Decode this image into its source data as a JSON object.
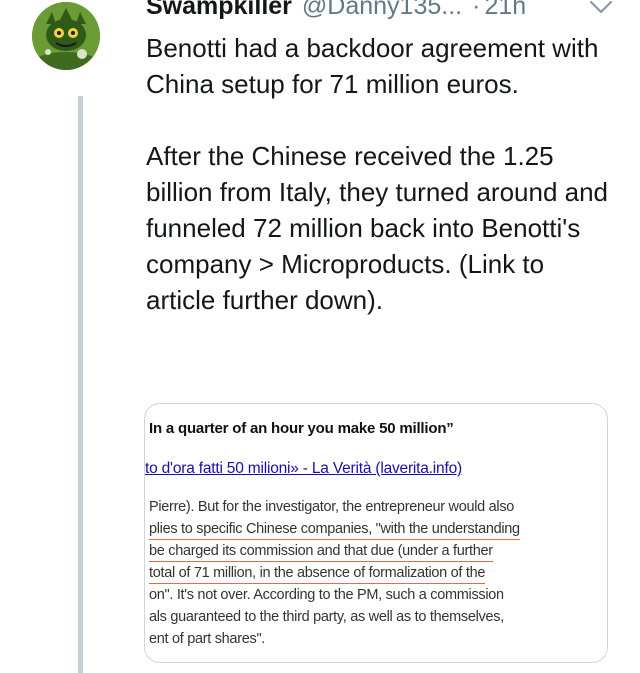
{
  "tweet": {
    "author": {
      "display_name": "Swampkiller",
      "handle": "@Danny135...",
      "avatar_icon": "cartoon-monster-avatar-icon"
    },
    "separator": "·",
    "timestamp": "21h",
    "more_icon": "chevron-down-icon",
    "text_paragraphs": [
      "Benotti had a backdoor agreement with China setup for 71 million euros.",
      "After the Chinese received the 1.25 billion from Italy, they turned around and funneled 72 million back into Benotti's company > Microproducts. (Link to article further down)."
    ]
  },
  "media_card": {
    "heading": "In a quarter of an hour you make 50 million”",
    "link_text": "to d'ora fatti 50 milioni» - La Verità (laverita.info)",
    "body_lines": [
      "Pierre). But for the investigator, the entrepreneur would also",
      "plies to specific Chinese companies, \"with the understanding",
      "be charged its commission and that due (under a further",
      "total of 71 million, in the absence of formalization of the",
      "on\". It's not over. According to the PM, such a commission",
      "als guaranteed to the third party, as well as to themselves,",
      "ent of part shares\"."
    ]
  },
  "colors": {
    "primary_text": "#14171a",
    "secondary_text": "#657786",
    "thread_line": "#c4cfd6",
    "card_border": "#ccd6dd",
    "link": "#1a0dab",
    "highlight_underline": "#e36d3c"
  }
}
